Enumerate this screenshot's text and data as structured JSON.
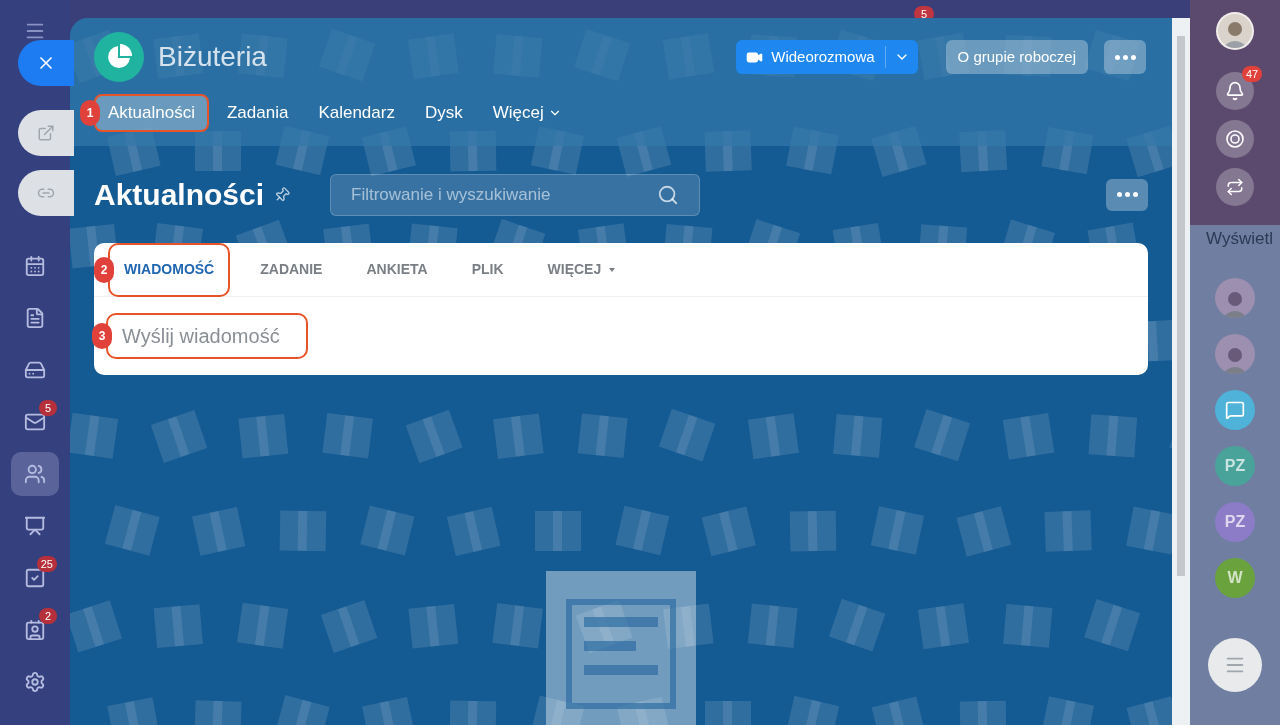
{
  "background_badge": "5",
  "sidebar": {
    "items": [
      {
        "selected": false
      },
      {
        "selected": false
      },
      {
        "selected": false
      },
      {
        "selected": false,
        "badge": "5"
      },
      {
        "selected": true
      },
      {
        "selected": false
      },
      {
        "selected": false,
        "badge": "25"
      },
      {
        "selected": false,
        "badge": "2"
      },
      {
        "selected": false
      }
    ]
  },
  "workgroup": {
    "title": "Biżuteria",
    "video_button": "Wideorozmowa",
    "about_button": "O grupie roboczej",
    "tabs": [
      {
        "label": "Aktualności",
        "selected": true,
        "marker": "1"
      },
      {
        "label": "Zadania",
        "selected": false
      },
      {
        "label": "Kalendarz",
        "selected": false
      },
      {
        "label": "Dysk",
        "selected": false
      },
      {
        "label": "Więcej",
        "selected": false,
        "dropdown": true
      }
    ]
  },
  "feed": {
    "title": "Aktualności",
    "search": {
      "placeholder": "Filtrowanie i wyszukiwanie"
    },
    "composer_tabs": [
      {
        "label": "WIADOMOŚĆ",
        "selected": true,
        "marker": "2"
      },
      {
        "label": "ZADANIE",
        "selected": false
      },
      {
        "label": "ANKIETA",
        "selected": false
      },
      {
        "label": "PLIK",
        "selected": false
      },
      {
        "label": "WIĘCEJ",
        "selected": false,
        "dropdown": true
      }
    ],
    "message_placeholder": "Wyślij wiadomość",
    "message_marker": "3"
  },
  "right_rail": {
    "notifications_badge": "47",
    "partial_text": "Wyświetl",
    "avatars": [
      {
        "kind": "photo"
      },
      {
        "kind": "photo"
      },
      {
        "kind": "chat",
        "color": "#4fb3d9"
      },
      {
        "kind": "initials",
        "text": "PZ",
        "color": "#4aa39a"
      },
      {
        "kind": "initials",
        "text": "PZ",
        "color": "#8c7cc7"
      },
      {
        "kind": "initials",
        "text": "W",
        "color": "#6aa33e"
      }
    ]
  }
}
